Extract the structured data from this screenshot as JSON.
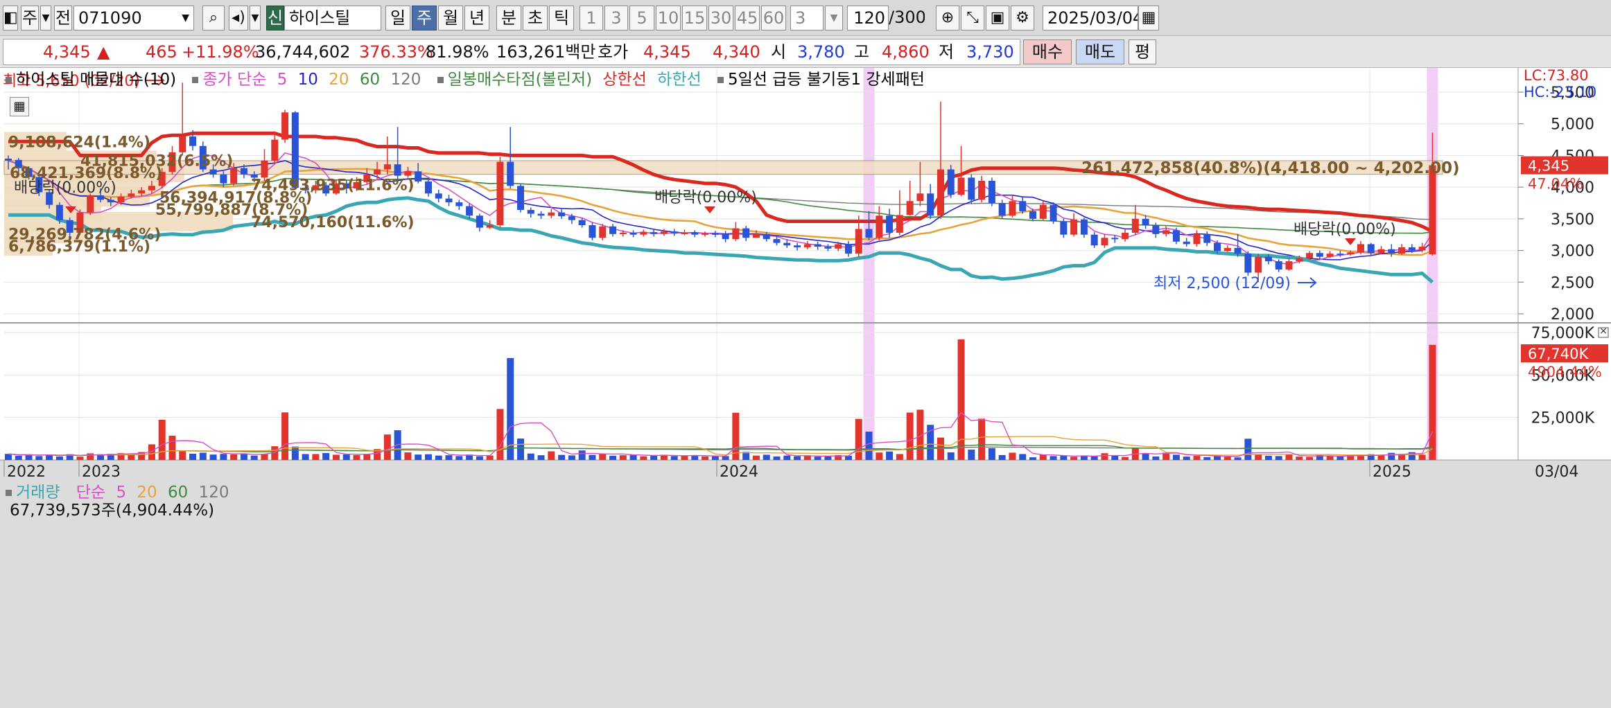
{
  "toolbar": {
    "period_label": "주",
    "prev_label": "전",
    "code_value": "071090",
    "credit_badge": "신",
    "stock_name": "하이스틸",
    "tabs": [
      "일",
      "주",
      "월",
      "년"
    ],
    "active_tab": "주",
    "intraday_tabs": [
      "분",
      "초",
      "틱"
    ],
    "minute_buttons": [
      "1",
      "3",
      "5",
      "10",
      "15",
      "30",
      "45",
      "60"
    ],
    "interval_value": "3",
    "bars_count": "120",
    "bars_total": "/300",
    "date_value": "2025/03/04"
  },
  "quote": {
    "price": "4,345",
    "change_arrow": "▲",
    "change": "465",
    "change_pct": "+11.98%",
    "volume": "36,744,602",
    "volume_ratio": "376.33%",
    "turnover_pct": "81.98%",
    "amount": "163,261백만",
    "bid_label": "호가",
    "ask_price": "4,345",
    "bid_price": "4,340",
    "open_label": "시",
    "open": "3,780",
    "high_label": "고",
    "high": "4,860",
    "low_label": "저",
    "low": "3,730",
    "buy_label": "매수",
    "sell_label": "매도",
    "eval_label": "평"
  },
  "legend": {
    "vp_label": "하이스틸 매물대 수(10)",
    "ma_label": "종가 단순",
    "ma_periods": [
      "5",
      "10",
      "20",
      "60",
      "120"
    ],
    "bollinger_label": "일봉매수타점(볼린저)",
    "upper_label": "상한선",
    "lower_label": "하한선",
    "pattern_label": "5일선 급등 불기둥1 강세패턴",
    "vol_label": "거래량",
    "vol_ma_label": "단순",
    "vol_periods": [
      "5",
      "20",
      "60",
      "120"
    ],
    "vol_current": "67,739,573주(4,904.44%)"
  },
  "side_labels": {
    "lc": "LC:73.80",
    "hc": "HC:-23.10",
    "price_tag": "4,345",
    "price_pct": "47.04%",
    "vol_tag": "67,740K",
    "vol_pct": "4904.44%"
  },
  "annotations": {
    "high": "최고 5,650 (02/20)",
    "low": "최저 2,500 (12/09)",
    "dividend1": "배당락(0.00%)",
    "dividend2": "배당락(0.00%)",
    "dividend3": "배당락(0.00%)"
  },
  "colors": {
    "up": "#e0342c",
    "down": "#2a54d6",
    "upper_band": "#d8281f",
    "lower_band": "#3aa5b3",
    "ma5": "#d64fc4",
    "ma10": "#2424c8",
    "ma20": "#e8a23a",
    "ma60": "#3d8a3d",
    "ma120": "#7a7a7a",
    "vp": "#f0dcc0",
    "highlight": "#f0c4f4"
  },
  "chart_data": {
    "type": "candlestick",
    "price_axis": {
      "ticks": [
        "5,500",
        "5,000",
        "4,500",
        "4,000",
        "3,500",
        "3,000",
        "2,500",
        "2,000"
      ],
      "ylim": [
        1900,
        5800
      ]
    },
    "volume_axis": {
      "ticks": [
        "75,000K",
        "50,000K",
        "25,000K"
      ],
      "ylim": [
        0,
        80000
      ]
    },
    "x_axis": {
      "labels": [
        "2022",
        "2023",
        "2024",
        "2025",
        "03/04"
      ]
    },
    "candles": [
      [
        4450,
        4420,
        4500,
        4280
      ],
      [
        4430,
        4300,
        4460,
        4240
      ],
      [
        4300,
        4160,
        4330,
        4120
      ],
      [
        4160,
        3920,
        4200,
        3860
      ],
      [
        3920,
        3720,
        3960,
        3660
      ],
      [
        3720,
        3480,
        3760,
        3420
      ],
      [
        3480,
        3280,
        3520,
        3200
      ],
      [
        3280,
        3600,
        3650,
        3250
      ],
      [
        3600,
        3870,
        3900,
        3560
      ],
      [
        3870,
        3800,
        3980,
        3760
      ],
      [
        3800,
        3760,
        3840,
        3700
      ],
      [
        3760,
        3850,
        3900,
        3720
      ],
      [
        3850,
        3900,
        3960,
        3820
      ],
      [
        3900,
        3950,
        4000,
        3860
      ],
      [
        3950,
        4020,
        4100,
        3900
      ],
      [
        4020,
        4240,
        4300,
        3980
      ],
      [
        4240,
        4550,
        4650,
        4200
      ],
      [
        4550,
        4800,
        5650,
        4500
      ],
      [
        4800,
        4650,
        4900,
        4580
      ],
      [
        4650,
        4280,
        4720,
        4240
      ],
      [
        4280,
        4200,
        4360,
        4150
      ],
      [
        4200,
        4060,
        4250,
        4000
      ],
      [
        4060,
        4300,
        4380,
        4020
      ],
      [
        4300,
        4200,
        4360,
        4140
      ],
      [
        4200,
        4150,
        4250,
        4080
      ],
      [
        4150,
        4420,
        4600,
        4100
      ],
      [
        4420,
        4750,
        4880,
        4380
      ],
      [
        4750,
        5180,
        5220,
        4700
      ],
      [
        5180,
        3990,
        5200,
        3960
      ],
      [
        3990,
        3950,
        4070,
        3900
      ],
      [
        3950,
        4030,
        4100,
        3900
      ],
      [
        4030,
        3900,
        4080,
        3860
      ],
      [
        3900,
        4060,
        4120,
        3880
      ],
      [
        4060,
        3980,
        4110,
        3900
      ],
      [
        3980,
        4080,
        4160,
        3940
      ],
      [
        4080,
        4200,
        4300,
        4040
      ],
      [
        4200,
        4280,
        4400,
        4120
      ],
      [
        4280,
        4360,
        4800,
        4200
      ],
      [
        4360,
        4180,
        4950,
        4120
      ],
      [
        4180,
        4250,
        4320,
        4150
      ],
      [
        4250,
        4090,
        4380,
        4060
      ],
      [
        4090,
        3900,
        4120,
        3850
      ],
      [
        3900,
        3820,
        3960,
        3760
      ],
      [
        3820,
        3760,
        3880,
        3700
      ],
      [
        3760,
        3700,
        3800,
        3640
      ],
      [
        3700,
        3550,
        3740,
        3500
      ],
      [
        3550,
        3360,
        3580,
        3300
      ],
      [
        3360,
        3400,
        3480,
        3340
      ],
      [
        3400,
        4400,
        4480,
        3360
      ],
      [
        4400,
        4020,
        4950,
        3980
      ],
      [
        4020,
        3640,
        4060,
        3600
      ],
      [
        3640,
        3580,
        3680,
        3520
      ],
      [
        3580,
        3550,
        3620,
        3500
      ],
      [
        3550,
        3600,
        3660,
        3510
      ],
      [
        3600,
        3540,
        3650,
        3500
      ],
      [
        3540,
        3480,
        3580,
        3420
      ],
      [
        3480,
        3400,
        3520,
        3360
      ],
      [
        3400,
        3200,
        3440,
        3160
      ],
      [
        3200,
        3380,
        3420,
        3160
      ],
      [
        3380,
        3260,
        3420,
        3220
      ],
      [
        3260,
        3280,
        3320,
        3220
      ],
      [
        3280,
        3250,
        3320,
        3210
      ],
      [
        3250,
        3290,
        3330,
        3220
      ],
      [
        3290,
        3260,
        3330,
        3220
      ],
      [
        3260,
        3300,
        3340,
        3230
      ],
      [
        3300,
        3270,
        3340,
        3230
      ],
      [
        3270,
        3280,
        3330,
        3240
      ],
      [
        3280,
        3250,
        3320,
        3210
      ],
      [
        3250,
        3270,
        3300,
        3220
      ],
      [
        3270,
        3260,
        3310,
        3210
      ],
      [
        3260,
        3180,
        3310,
        3130
      ],
      [
        3180,
        3350,
        3450,
        3150
      ],
      [
        3350,
        3200,
        3390,
        3150
      ],
      [
        3200,
        3260,
        3320,
        3200
      ],
      [
        3260,
        3180,
        3290,
        3140
      ],
      [
        3180,
        3120,
        3230,
        3080
      ],
      [
        3120,
        3080,
        3180,
        3040
      ],
      [
        3080,
        3050,
        3120,
        3000
      ],
      [
        3050,
        3100,
        3150,
        3020
      ],
      [
        3100,
        3060,
        3140,
        3010
      ],
      [
        3060,
        3030,
        3100,
        2990
      ],
      [
        3030,
        3100,
        3140,
        2990
      ],
      [
        3100,
        2950,
        3150,
        2900
      ],
      [
        2950,
        3340,
        3550,
        2900
      ],
      [
        3340,
        3200,
        3620,
        3160
      ],
      [
        3200,
        3550,
        3700,
        3160
      ],
      [
        3550,
        3280,
        3660,
        3200
      ],
      [
        3280,
        3560,
        3950,
        3240
      ],
      [
        3560,
        3780,
        4100,
        3550
      ],
      [
        3780,
        3900,
        4400,
        3700
      ],
      [
        3900,
        3550,
        4050,
        3500
      ],
      [
        3550,
        4280,
        5350,
        3500
      ],
      [
        4280,
        3880,
        4350,
        3830
      ],
      [
        3880,
        4150,
        4650,
        3860
      ],
      [
        4150,
        3800,
        4200,
        3740
      ],
      [
        3800,
        4100,
        4180,
        3760
      ],
      [
        4100,
        3750,
        4150,
        3700
      ],
      [
        3750,
        3550,
        3800,
        3500
      ],
      [
        3550,
        3780,
        3880,
        3520
      ],
      [
        3780,
        3620,
        3840,
        3580
      ],
      [
        3620,
        3500,
        3660,
        3460
      ],
      [
        3500,
        3720,
        3790,
        3480
      ],
      [
        3720,
        3460,
        3760,
        3420
      ],
      [
        3460,
        3250,
        3500,
        3200
      ],
      [
        3250,
        3490,
        3590,
        3220
      ],
      [
        3490,
        3250,
        3520,
        3200
      ],
      [
        3250,
        3080,
        3290,
        3040
      ],
      [
        3080,
        3200,
        3260,
        3040
      ],
      [
        3200,
        3180,
        3240,
        3120
      ],
      [
        3180,
        3280,
        3340,
        3140
      ],
      [
        3280,
        3500,
        3720,
        3240
      ],
      [
        3500,
        3400,
        3560,
        3340
      ],
      [
        3400,
        3260,
        3440,
        3200
      ],
      [
        3260,
        3320,
        3380,
        3220
      ],
      [
        3320,
        3140,
        3360,
        3100
      ],
      [
        3140,
        3100,
        3200,
        3060
      ],
      [
        3100,
        3260,
        3320,
        3060
      ],
      [
        3260,
        3120,
        3300,
        3070
      ],
      [
        3120,
        2990,
        3160,
        2950
      ],
      [
        2990,
        3040,
        3080,
        2980
      ],
      [
        3040,
        2950,
        3260,
        2900
      ],
      [
        2950,
        2650,
        2990,
        2600
      ],
      [
        2650,
        2900,
        2950,
        2500
      ],
      [
        2900,
        2830,
        2940,
        2780
      ],
      [
        2830,
        2700,
        2860,
        2660
      ],
      [
        2700,
        2830,
        2880,
        2680
      ],
      [
        2830,
        2880,
        2920,
        2800
      ],
      [
        2880,
        2960,
        2990,
        2850
      ],
      [
        2960,
        2900,
        3000,
        2860
      ],
      [
        2900,
        2950,
        2990,
        2880
      ],
      [
        2950,
        2940,
        3000,
        2900
      ],
      [
        2940,
        2970,
        3000,
        2920
      ],
      [
        2970,
        3100,
        3150,
        2940
      ],
      [
        3100,
        2960,
        3120,
        2930
      ],
      [
        2960,
        3020,
        3070,
        2940
      ],
      [
        3020,
        2950,
        3100,
        2900
      ],
      [
        2950,
        3050,
        3100,
        2930
      ],
      [
        3050,
        3000,
        3100,
        2960
      ],
      [
        3000,
        3060,
        3120,
        2970
      ],
      [
        2940,
        4345,
        4860,
        2920
      ]
    ],
    "volume_k": [
      3600,
      2500,
      3100,
      2300,
      3300,
      2100,
      3400,
      2000,
      3900,
      3400,
      3600,
      4000,
      3500,
      4700,
      9200,
      23700,
      14300,
      5200,
      3700,
      4300,
      3200,
      3600,
      3300,
      3900,
      2600,
      3700,
      8100,
      28000,
      7900,
      3500,
      3500,
      4100,
      3100,
      3300,
      2900,
      3600,
      6400,
      15000,
      17500,
      4500,
      3200,
      3400,
      2600,
      2800,
      2300,
      3200,
      2200,
      2600,
      30000,
      60000,
      12600,
      3800,
      2800,
      5100,
      3000,
      2700,
      5600,
      3000,
      3800,
      2500,
      2800,
      3100,
      2200,
      2600,
      3100,
      2300,
      2500,
      2800,
      2100,
      2200,
      2300,
      27800,
      4800,
      2600,
      3100,
      2100,
      2600,
      2200,
      2700,
      2000,
      2100,
      2900,
      2500,
      24200,
      16700,
      4400,
      5000,
      3500,
      27900,
      29600,
      20700,
      13200,
      4500,
      71000,
      6100,
      24300,
      7000,
      2900,
      4300,
      3500,
      1600,
      3100,
      2300,
      2600,
      1900,
      2500,
      2200,
      4000,
      2500,
      1800,
      7200,
      4100,
      2100,
      4300,
      3100,
      2000,
      2400,
      1700,
      2700,
      1900,
      1500,
      12500,
      3100,
      2500,
      2300,
      3200,
      2000,
      1800,
      2900,
      2400,
      2100,
      3100,
      2400,
      3400,
      2900,
      4200,
      3600,
      4600,
      3100,
      67740
    ],
    "upper_band": [
      4720,
      4720,
      4720,
      4720,
      4720,
      4720,
      4720,
      4500,
      4500,
      4500,
      4500,
      4500,
      4500,
      4500,
      4700,
      4800,
      4820,
      4820,
      4850,
      4850,
      4850,
      4850,
      4850,
      4850,
      4850,
      4850,
      4850,
      4800,
      4800,
      4800,
      4800,
      4780,
      4780,
      4760,
      4740,
      4680,
      4640,
      4640,
      4640,
      4620,
      4620,
      4560,
      4540,
      4540,
      4540,
      4540,
      4540,
      4520,
      4520,
      4500,
      4500,
      4500,
      4500,
      4500,
      4500,
      4500,
      4500,
      4480,
      4480,
      4480,
      4420,
      4350,
      4270,
      4200,
      4150,
      4120,
      4100,
      4080,
      4060,
      4060,
      4040,
      4000,
      3900,
      3780,
      3560,
      3500,
      3460,
      3460,
      3460,
      3460,
      3460,
      3460,
      3460,
      3460,
      3460,
      3460,
      3460,
      3490,
      3500,
      3500,
      3600,
      3880,
      4160,
      4200,
      4270,
      4300,
      4300,
      4300,
      4300,
      4300,
      4300,
      4300,
      4300,
      4290,
      4270,
      4260,
      4240,
      4220,
      4210,
      4200,
      4160,
      4090,
      4010,
      3950,
      3880,
      3820,
      3780,
      3750,
      3720,
      3700,
      3690,
      3680,
      3660,
      3650,
      3650,
      3640,
      3630,
      3620,
      3610,
      3600,
      3590,
      3570,
      3550,
      3540,
      3520,
      3500,
      3470,
      3440,
      3380,
      3300
    ],
    "lower_band": [
      3560,
      3560,
      3560,
      3560,
      3560,
      3480,
      3440,
      3420,
      3320,
      3320,
      3300,
      3300,
      3250,
      3210,
      3220,
      3250,
      3260,
      3250,
      3250,
      3290,
      3300,
      3320,
      3380,
      3400,
      3420,
      3420,
      3460,
      3420,
      3420,
      3500,
      3540,
      3560,
      3620,
      3700,
      3740,
      3760,
      3760,
      3800,
      3820,
      3830,
      3800,
      3780,
      3680,
      3600,
      3550,
      3500,
      3450,
      3400,
      3340,
      3340,
      3320,
      3320,
      3280,
      3230,
      3200,
      3160,
      3120,
      3100,
      3070,
      3050,
      3040,
      3030,
      3010,
      3000,
      2990,
      2980,
      2960,
      2960,
      2950,
      2940,
      2930,
      2920,
      2910,
      2890,
      2880,
      2870,
      2860,
      2850,
      2850,
      2840,
      2840,
      2840,
      2850,
      2880,
      2900,
      2960,
      2960,
      2960,
      2930,
      2880,
      2840,
      2760,
      2700,
      2700,
      2600,
      2570,
      2580,
      2550,
      2560,
      2580,
      2610,
      2640,
      2680,
      2740,
      2760,
      2760,
      2810,
      2970,
      3040,
      3040,
      3040,
      3040,
      3040,
      3020,
      3010,
      3000,
      2980,
      2980,
      2960,
      2950,
      2940,
      2930,
      2920,
      2920,
      2900,
      2890,
      2880,
      2840,
      2790,
      2760,
      2720,
      2700,
      2680,
      2660,
      2640,
      2620,
      2620,
      2620,
      2640,
      2500
    ]
  }
}
